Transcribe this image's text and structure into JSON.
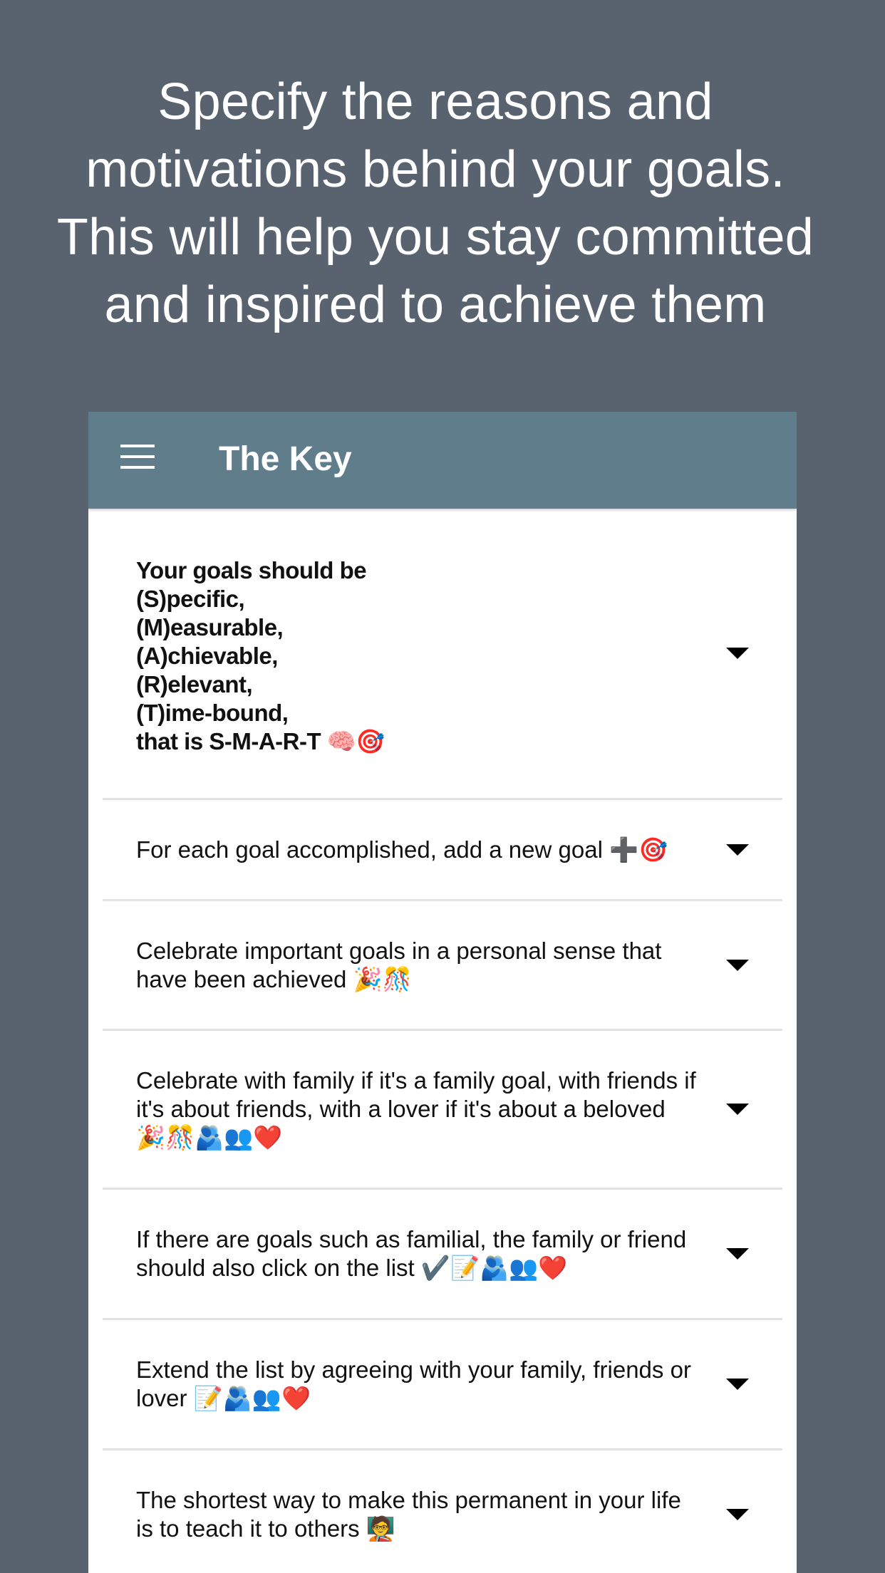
{
  "headline": {
    "line1": "Specify the reasons and",
    "line2": "motivations behind your goals.",
    "line3": "This will help you stay committed",
    "line4": "and inspired to achieve them"
  },
  "appbar": {
    "menu_icon": "hamburger-menu-icon",
    "title": "The Key"
  },
  "caret_icon": "caret-down-icon",
  "items": [
    {
      "lines": [
        "Your goals should be",
        "(S)pecific,",
        "(M)easurable,",
        "(A)chievable,",
        "(R)elevant,",
        "(T)ime-bound,",
        "that is S-M-A-R-T 🧠🎯"
      ]
    },
    {
      "text": "For each goal accomplished, add a new goal ➕🎯"
    },
    {
      "text": "Celebrate important goals in a personal sense that have been achieved 🎉🎊"
    },
    {
      "text": "Celebrate with family if it's a family goal, with friends if it's about friends, with a lover if it's about a beloved 🎉🎊🫂👥❤️"
    },
    {
      "text": "If there are goals such as familial, the family or friend should also click on the list ✔️📝🫂👥❤️"
    },
    {
      "text": "Extend the list by agreeing with your family, friends or lover 📝🫂👥❤️"
    },
    {
      "text": "The shortest way to make this permanent in your life is to teach it to others 🧑‍🏫"
    }
  ]
}
